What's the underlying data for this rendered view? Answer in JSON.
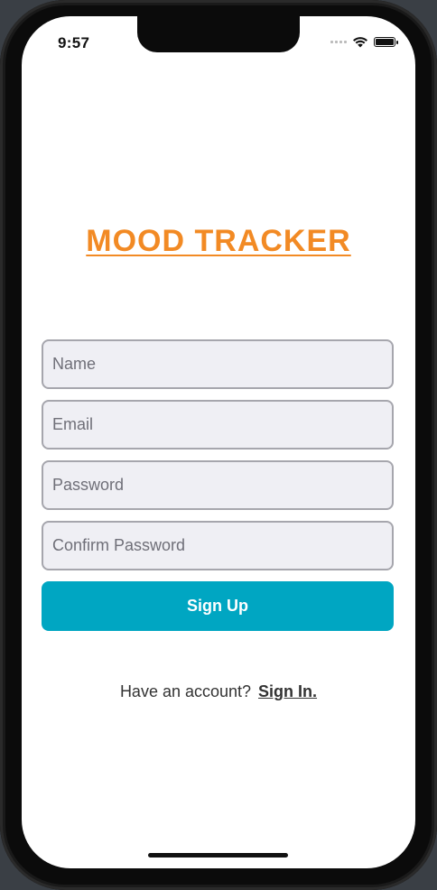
{
  "status_bar": {
    "time": "9:57",
    "icons": [
      "cellular-signal-icon",
      "wifi-icon",
      "battery-icon"
    ]
  },
  "app": {
    "title": "MOOD TRACKER",
    "accent_color": "#f28a24"
  },
  "form": {
    "name_placeholder": "Name",
    "email_placeholder": "Email",
    "password_placeholder": "Password",
    "confirm_password_placeholder": "Confirm Password",
    "submit_label": "Sign Up",
    "submit_color": "#00a6c2"
  },
  "footer": {
    "prompt": "Have an account?",
    "link_label": "Sign In."
  }
}
